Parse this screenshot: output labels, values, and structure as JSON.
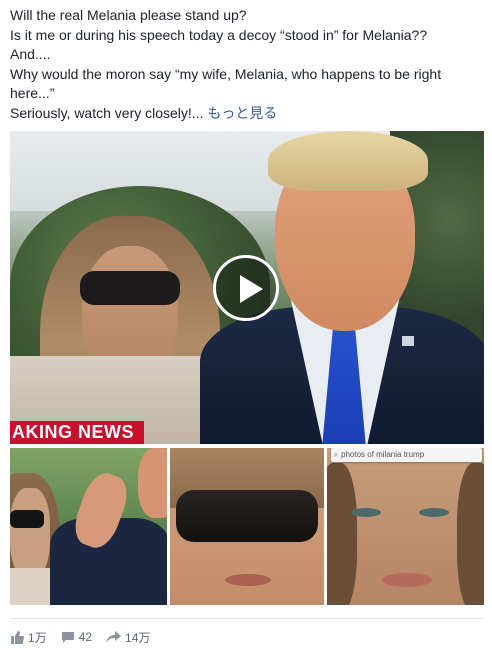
{
  "post": {
    "lines": [
      "Will the real Melania please stand up?",
      "Is it me or during his speech today a decoy “stood in” for Melania??",
      "And....",
      "Why would the moron say “my wife, Melania, who happens to be right",
      "here...”",
      "Seriously, watch very closely!... "
    ],
    "see_more": "もっと見る"
  },
  "video": {
    "banner": "AKING NEWS",
    "play_icon": "play-icon"
  },
  "thumbs": {
    "search_text": "photos of milania trump"
  },
  "footer": {
    "likes": "1万",
    "comments": "42",
    "shares": "14万"
  },
  "colors": {
    "link": "#385898",
    "breaking": "#c8102e",
    "meta": "#606770"
  }
}
